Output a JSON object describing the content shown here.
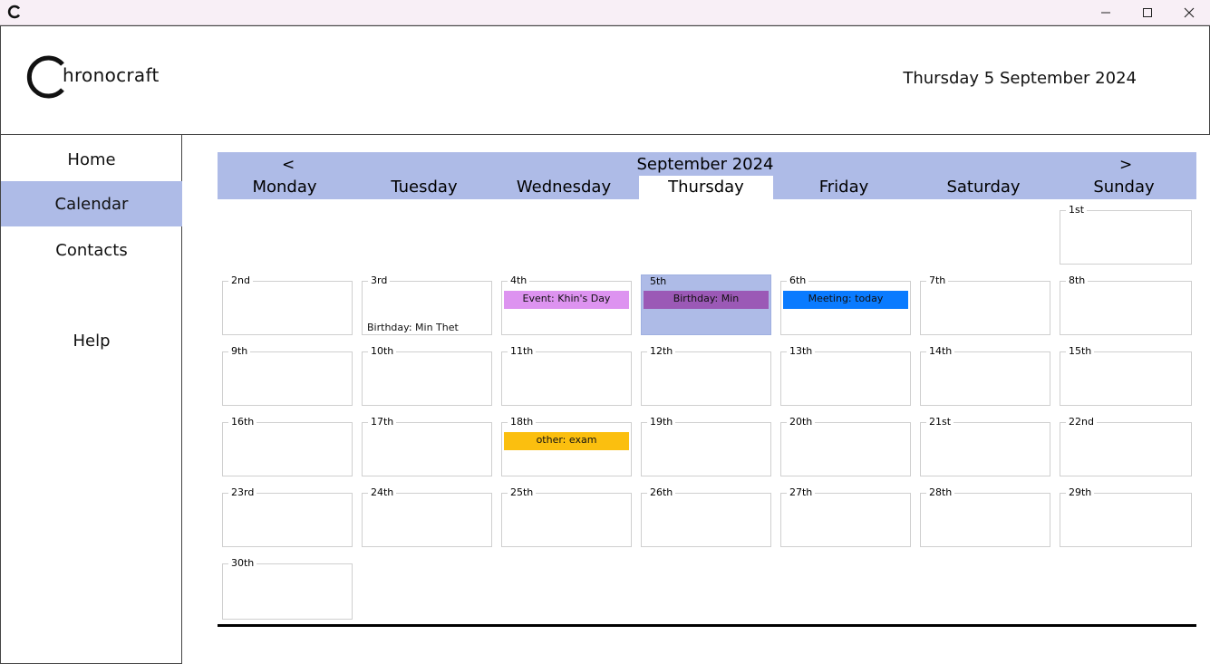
{
  "window": {
    "minimize_icon": "minimize-icon",
    "maximize_icon": "maximize-icon",
    "close_icon": "close-icon"
  },
  "header": {
    "logo_text": "hronocraft",
    "date": "Thursday 5 September 2024"
  },
  "sidebar": {
    "items": [
      {
        "label": "Home"
      },
      {
        "label": "Calendar",
        "active": true
      },
      {
        "label": "Contacts"
      },
      {
        "label": "Help"
      }
    ]
  },
  "calendar": {
    "prev": "<",
    "next": ">",
    "month": "September 2024",
    "days": [
      "Monday",
      "Tuesday",
      "Wednesday",
      "Thursday",
      "Friday",
      "Saturday",
      "Sunday"
    ],
    "active_day": "Thursday",
    "dates": [
      "1st",
      "2nd",
      "3rd",
      "4th",
      "5th",
      "6th",
      "7th",
      "8th",
      "9th",
      "10th",
      "11th",
      "12th",
      "13th",
      "14th",
      "15th",
      "16th",
      "17th",
      "18th",
      "19th",
      "20th",
      "21st",
      "22nd",
      "23rd",
      "24th",
      "25th",
      "26th",
      "27th",
      "28th",
      "29th",
      "30th"
    ],
    "events": {
      "birthday_min_thet": "Birthday: Min Thet",
      "event_khins_day": "Event: Khin's Day",
      "birthday_min": "Birthday: Min",
      "meeting_today": "Meeting: today",
      "other_exam": "other: exam"
    },
    "event_colors": {
      "event": "#dd93f0",
      "birthday": "#9b59b6",
      "meeting": "#0a7bff",
      "other": "#fbbf0f"
    },
    "today_color": "#aebbe7"
  }
}
